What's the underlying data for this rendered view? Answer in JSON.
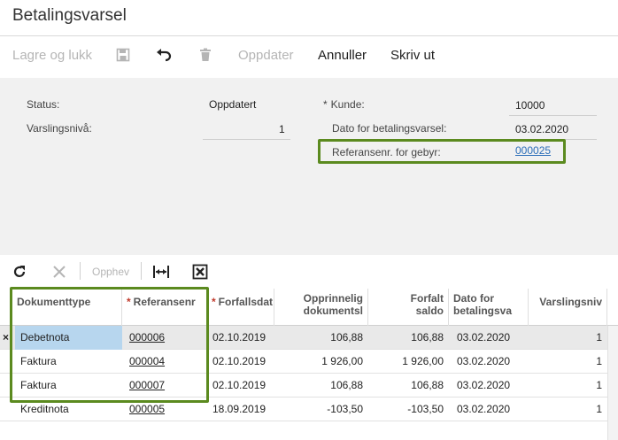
{
  "window": {
    "title": "Betalingsvarsel"
  },
  "toolbar": {
    "save_close": "Lagre og lukk",
    "update": "Oppdater",
    "cancel": "Annuller",
    "print": "Skriv ut",
    "icons": [
      "save-icon",
      "undo-icon",
      "delete-icon"
    ]
  },
  "form": {
    "status_label": "Status:",
    "status_value": "Oppdatert",
    "level_label": "Varslingsnivå:",
    "level_value": "1",
    "customer_label": "Kunde:",
    "customer_required_mark": "*",
    "customer_value": "10000",
    "date_label": "Dato for betalingsvarsel:",
    "date_value": "03.02.2020",
    "fee_ref_label": "Referansenr. for gebyr:",
    "fee_ref_value": "000025"
  },
  "grid_toolbar": {
    "reverse": "Opphev",
    "icons": [
      "refresh-icon",
      "cancel-x-icon",
      "fit-columns-icon",
      "export-excel-icon"
    ]
  },
  "grid": {
    "columns": [
      {
        "label": "Dokumenttype",
        "required": false
      },
      {
        "label": "Referansenr",
        "required": true
      },
      {
        "label": "Forfallsdat",
        "required": true
      },
      {
        "label": "Opprinnelig dokumentsl",
        "required": false
      },
      {
        "label": "Forfalt saldo",
        "required": false
      },
      {
        "label": "Dato for betalingsva",
        "required": false
      },
      {
        "label": "Varslingsniv",
        "required": false
      }
    ],
    "rows": [
      {
        "type": "Debetnota",
        "ref": "000006",
        "due": "02.10.2019",
        "orig": "106,88",
        "overdue": "106,88",
        "date": "03.02.2020",
        "level": "1"
      },
      {
        "type": "Faktura",
        "ref": "000004",
        "due": "02.10.2019",
        "orig": "1 926,00",
        "overdue": "1 926,00",
        "date": "03.02.2020",
        "level": "1"
      },
      {
        "type": "Faktura",
        "ref": "000007",
        "due": "02.10.2019",
        "orig": "106,88",
        "overdue": "106,88",
        "date": "03.02.2020",
        "level": "1"
      },
      {
        "type": "Kreditnota",
        "ref": "000005",
        "due": "18.09.2019",
        "orig": "-103,50",
        "overdue": "-103,50",
        "date": "03.02.2020",
        "level": "1"
      }
    ],
    "colors": {
      "highlight": "#5b8a1f",
      "selected_cell": "#b7d6ee",
      "link": "#2a6db8"
    }
  }
}
